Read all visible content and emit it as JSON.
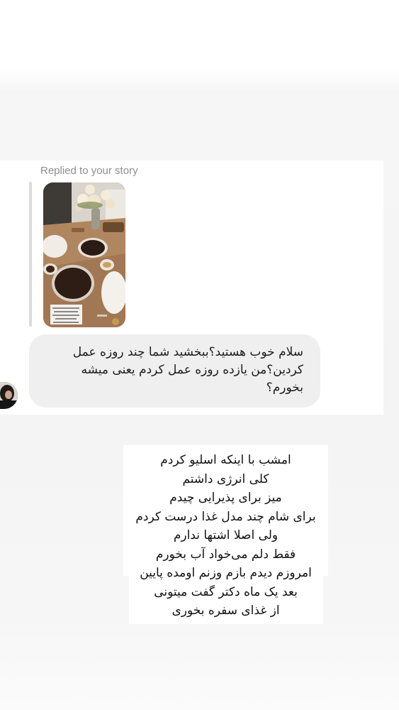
{
  "reply_header": {
    "label": "Replied to your story"
  },
  "message": {
    "text": "سلام خوب هستید؟ببخشید شما چند روزه عمل\nکردین؟من یازده روزه عمل کردم یعنی میشه\nبخورم؟"
  },
  "story_caption": {
    "text": "امشب با اینکه اسلیو کردم\nکلی انرژی داشتم\nمیز برای پذیرایی چیدم\nبرای شام چند مدل غذا درست کردم\nولی اصلا اشتها ندارم\nفقط دلم می‌خواد آب بخورم\nامروزم دیدم بازم وزنم اومده پایین\nبعد یک ماه دکتر گفت میتونی\nاز غذای سفره بخوری"
  },
  "icons": {
    "story_thumbnail": "dinner-table-photo",
    "sender_avatar": "profile-photo"
  },
  "colors": {
    "bubble": "#efefef",
    "label": "#8e8e8e",
    "reply_bar": "#dbdbdb"
  }
}
